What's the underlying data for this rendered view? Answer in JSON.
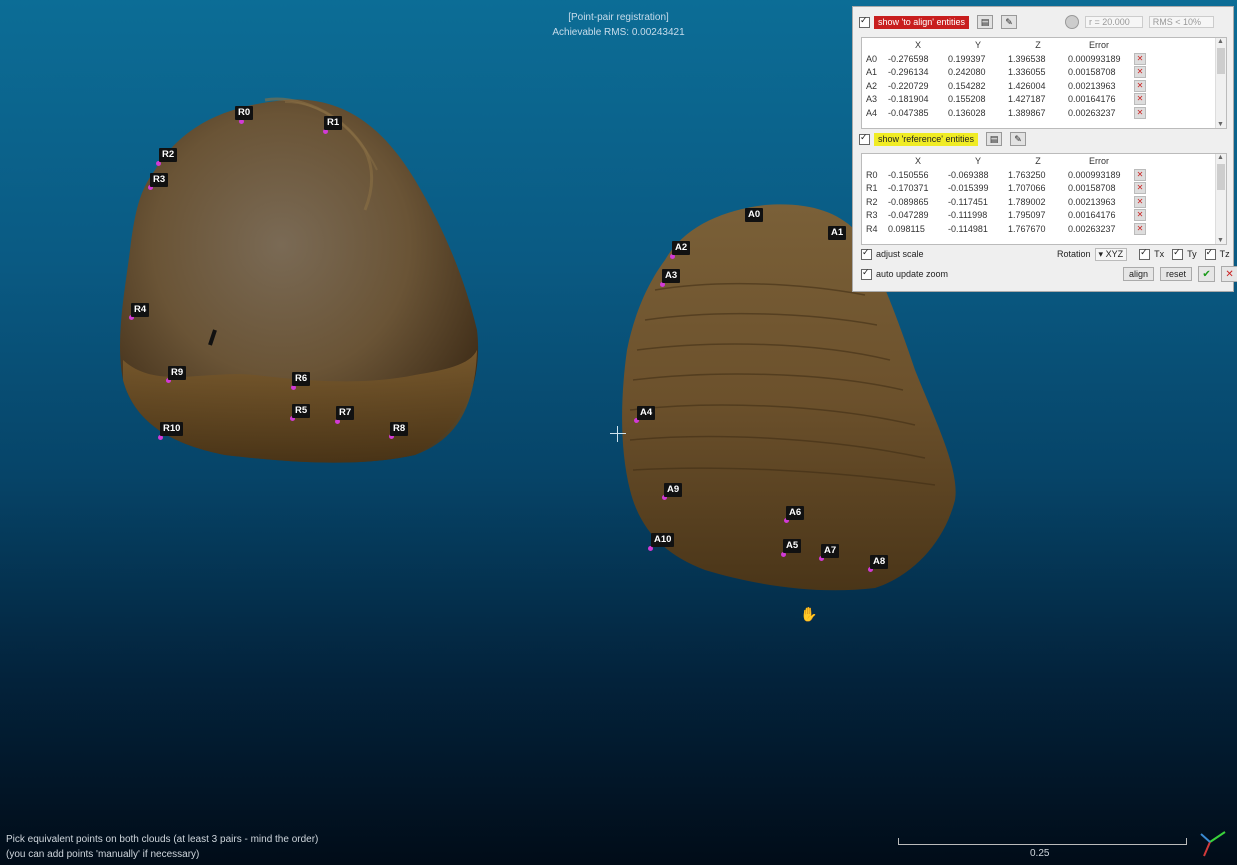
{
  "overlay": {
    "title": "[Point-pair registration]",
    "rms": "Achievable RMS: 0.00243421"
  },
  "footer": {
    "line1": "Pick equivalent points on both clouds (at least 3 pairs - mind the order)",
    "line2": "(you can add points 'manually' if necessary)",
    "scale": "0.25"
  },
  "left_points": [
    {
      "label": "R0"
    },
    {
      "label": "R1"
    },
    {
      "label": "R2"
    },
    {
      "label": "R3"
    },
    {
      "label": "R4"
    },
    {
      "label": "R9"
    },
    {
      "label": "R6"
    },
    {
      "label": "R5"
    },
    {
      "label": "R7"
    },
    {
      "label": "R8"
    },
    {
      "label": "R10"
    }
  ],
  "right_points": [
    {
      "label": "A0"
    },
    {
      "label": "A1"
    },
    {
      "label": "A2"
    },
    {
      "label": "A3"
    },
    {
      "label": "A4"
    },
    {
      "label": "A9"
    },
    {
      "label": "A6"
    },
    {
      "label": "A10"
    },
    {
      "label": "A5"
    },
    {
      "label": "A7"
    },
    {
      "label": "A8"
    }
  ],
  "panel": {
    "to_align_label": "show 'to align' entities",
    "radius": "r = 20.000",
    "rms_filter": "RMS < 10%",
    "reference_label": "show 'reference' entities",
    "columns": [
      "X",
      "Y",
      "Z",
      "Error"
    ],
    "align_rows": [
      {
        "id": "A0",
        "x": "-0.276598",
        "y": "0.199397",
        "z": "1.396538",
        "err": "0.000993189"
      },
      {
        "id": "A1",
        "x": "-0.296134",
        "y": "0.242080",
        "z": "1.336055",
        "err": "0.00158708"
      },
      {
        "id": "A2",
        "x": "-0.220729",
        "y": "0.154282",
        "z": "1.426004",
        "err": "0.00213963"
      },
      {
        "id": "A3",
        "x": "-0.181904",
        "y": "0.155208",
        "z": "1.427187",
        "err": "0.00164176"
      },
      {
        "id": "A4",
        "x": "-0.047385",
        "y": "0.136028",
        "z": "1.389867",
        "err": "0.00263237"
      }
    ],
    "ref_rows": [
      {
        "id": "R0",
        "x": "-0.150556",
        "y": "-0.069388",
        "z": "1.763250",
        "err": "0.000993189"
      },
      {
        "id": "R1",
        "x": "-0.170371",
        "y": "-0.015399",
        "z": "1.707066",
        "err": "0.00158708"
      },
      {
        "id": "R2",
        "x": "-0.089865",
        "y": "-0.117451",
        "z": "1.789002",
        "err": "0.00213963"
      },
      {
        "id": "R3",
        "x": "-0.047289",
        "y": "-0.111998",
        "z": "1.795097",
        "err": "0.00164176"
      },
      {
        "id": "R4",
        "x": "0.098115",
        "y": "-0.114981",
        "z": "1.767670",
        "err": "0.00263237"
      }
    ],
    "adjust_scale": "adjust scale",
    "rotation_label": "Rotation",
    "rotation_value": "XYZ",
    "tx": "Tx",
    "ty": "Ty",
    "tz": "Tz",
    "auto_update_zoom": "auto update zoom",
    "align": "align",
    "reset": "reset"
  },
  "colors": {
    "marker": "#d23ad6",
    "to_align": "#c81e1e",
    "reference": "#f0ec25"
  }
}
